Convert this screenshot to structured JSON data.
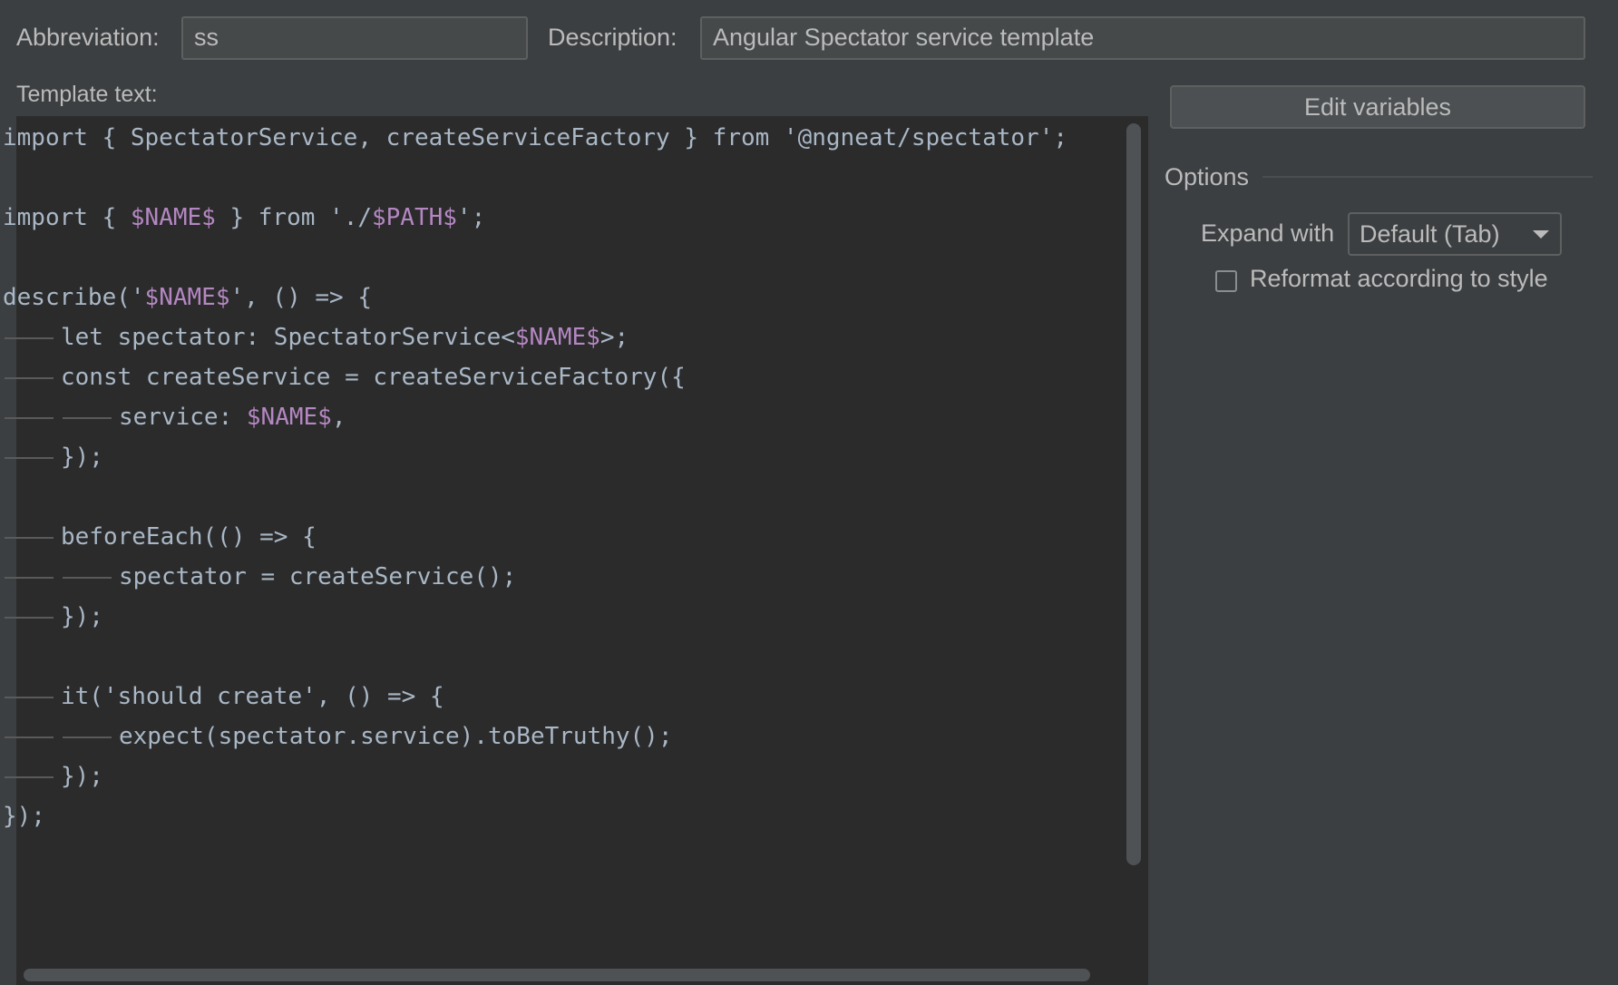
{
  "fields": {
    "abbreviation_label": "Abbreviation:",
    "abbreviation_value": "ss",
    "description_label": "Description:",
    "description_value": "Angular Spectator service template"
  },
  "template": {
    "label": "Template text:",
    "lines": [
      {
        "indent": 0,
        "tokens": [
          {
            "t": "import { SpectatorService, createServiceFactory } from '@ngneat/spectator';",
            "k": "text"
          }
        ]
      },
      {
        "indent": 0,
        "tokens": []
      },
      {
        "indent": 0,
        "tokens": [
          {
            "t": "import { ",
            "k": "text"
          },
          {
            "t": "$NAME$",
            "k": "var"
          },
          {
            "t": " } from './",
            "k": "text"
          },
          {
            "t": "$PATH$",
            "k": "var"
          },
          {
            "t": "';",
            "k": "text"
          }
        ]
      },
      {
        "indent": 0,
        "tokens": []
      },
      {
        "indent": 0,
        "tokens": [
          {
            "t": "describe('",
            "k": "text"
          },
          {
            "t": "$NAME$",
            "k": "var"
          },
          {
            "t": "', () => {",
            "k": "text"
          }
        ]
      },
      {
        "indent": 1,
        "tokens": [
          {
            "t": "let spectator: SpectatorService<",
            "k": "text"
          },
          {
            "t": "$NAME$",
            "k": "var"
          },
          {
            "t": ">;",
            "k": "text"
          }
        ]
      },
      {
        "indent": 1,
        "tokens": [
          {
            "t": "const createService = createServiceFactory({",
            "k": "text"
          }
        ]
      },
      {
        "indent": 2,
        "tokens": [
          {
            "t": "service: ",
            "k": "text"
          },
          {
            "t": "$NAME$",
            "k": "var"
          },
          {
            "t": ",",
            "k": "text"
          }
        ]
      },
      {
        "indent": 1,
        "tokens": [
          {
            "t": "});",
            "k": "text"
          }
        ]
      },
      {
        "indent": 0,
        "tokens": []
      },
      {
        "indent": 1,
        "tokens": [
          {
            "t": "beforeEach(() => {",
            "k": "text"
          }
        ]
      },
      {
        "indent": 2,
        "tokens": [
          {
            "t": "spectator = createService();",
            "k": "text"
          }
        ]
      },
      {
        "indent": 1,
        "tokens": [
          {
            "t": "});",
            "k": "text"
          }
        ]
      },
      {
        "indent": 0,
        "tokens": []
      },
      {
        "indent": 1,
        "tokens": [
          {
            "t": "it('should create', () => {",
            "k": "text"
          }
        ]
      },
      {
        "indent": 2,
        "tokens": [
          {
            "t": "expect(spectator.service).toBeTruthy();",
            "k": "text"
          }
        ]
      },
      {
        "indent": 1,
        "tokens": [
          {
            "t": "});",
            "k": "text"
          }
        ]
      },
      {
        "indent": 0,
        "tokens": [
          {
            "t": "});",
            "k": "text"
          }
        ]
      }
    ]
  },
  "side": {
    "edit_variables_label": "Edit variables",
    "options_label": "Options",
    "expand_with_label": "Expand with",
    "expand_with_value": "Default (Tab)",
    "reformat_label": "Reformat according to style",
    "reformat_checked": false
  }
}
